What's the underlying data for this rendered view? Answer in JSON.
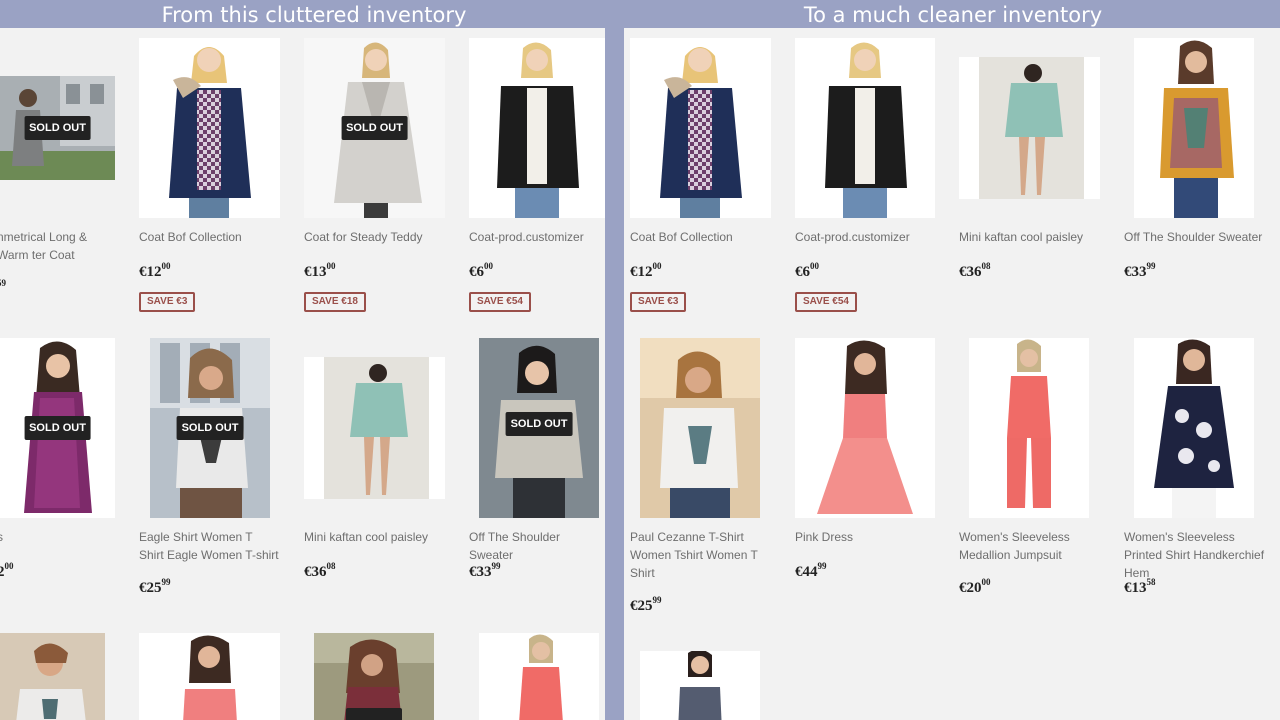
{
  "headings": {
    "left": "From this cluttered inventory",
    "right": "To a much cleaner inventory"
  },
  "colors": {
    "bar": "#9aa2c4",
    "panel": "#f2f2f2",
    "save_border": "#9a4f4a",
    "sold_badge": "#222222"
  },
  "left": {
    "products": [
      {
        "name": "nmetrical Long & Warm ter Coat",
        "price_main": "",
        "price_cents": "59",
        "save": "",
        "sold_out": "SOLD OUT",
        "icon": "grey-coat-photo"
      },
      {
        "name": "Coat Bof Collection",
        "price_main": "€12",
        "price_cents": "00",
        "save": "SAVE €3",
        "sold_out": "",
        "icon": "navy-parka-photo"
      },
      {
        "name": "Coat for Steady Teddy",
        "price_main": "€13",
        "price_cents": "00",
        "save": "SAVE €18",
        "sold_out": "SOLD OUT",
        "icon": "beige-coat-photo"
      },
      {
        "name": "Coat-prod.customizer",
        "price_main": "€6",
        "price_cents": "00",
        "save": "SAVE €54",
        "sold_out": "",
        "icon": "leather-jacket-photo"
      },
      {
        "name": "s",
        "price_main": "",
        "price_cents": "00",
        "price_prefix": "2",
        "save": "",
        "sold_out": "SOLD OUT",
        "icon": "purple-dress-photo"
      },
      {
        "name": "Eagle Shirt Women T Shirt Eagle Women T-shirt",
        "price_main": "€25",
        "price_cents": "99",
        "save": "",
        "sold_out": "SOLD OUT",
        "icon": "eagle-tshirt-photo"
      },
      {
        "name": "Mini kaftan cool paisley",
        "price_main": "€36",
        "price_cents": "08",
        "save": "",
        "sold_out": "",
        "icon": "kaftan-photo"
      },
      {
        "name": "Off The Shoulder Sweater",
        "price_main": "€33",
        "price_cents": "99",
        "save": "",
        "sold_out": "SOLD OUT",
        "icon": "sweater-photo"
      },
      {
        "name": "",
        "icon": "tshirt-photo"
      },
      {
        "name": "",
        "icon": "pink-dress-photo"
      },
      {
        "name": "",
        "icon": "floral-dress-photo"
      },
      {
        "name": "",
        "icon": "jumpsuit-photo"
      }
    ]
  },
  "right": {
    "products": [
      {
        "name": "Coat Bof Collection",
        "price_main": "€12",
        "price_cents": "00",
        "save": "SAVE €3",
        "icon": "navy-parka-photo"
      },
      {
        "name": "Coat-prod.customizer",
        "price_main": "€6",
        "price_cents": "00",
        "save": "SAVE €54",
        "icon": "leather-jacket-photo"
      },
      {
        "name": "Mini kaftan cool paisley",
        "price_main": "€36",
        "price_cents": "08",
        "save": "",
        "icon": "kaftan-photo"
      },
      {
        "name": "Off The Shoulder Sweater",
        "price_main": "€33",
        "price_cents": "99",
        "save": "",
        "icon": "paisley-top-photo"
      },
      {
        "name": "Paul Cezanne T-Shirt Women Tshirt Women T Shirt",
        "price_main": "€25",
        "price_cents": "99",
        "save": "",
        "icon": "tshirt-photo"
      },
      {
        "name": "Pink Dress",
        "price_main": "€44",
        "price_cents": "99",
        "save": "",
        "icon": "pink-dress-photo"
      },
      {
        "name": "Women's Sleeveless Medallion Jumpsuit",
        "price_main": "€20",
        "price_cents": "00",
        "save": "",
        "icon": "jumpsuit-photo"
      },
      {
        "name": "Women's Sleeveless Printed Shirt Handkerchief Hem",
        "price_main": "€13",
        "price_cents": "58",
        "save": "",
        "icon": "printed-top-photo"
      },
      {
        "name": "",
        "icon": "strapless-top-photo"
      }
    ]
  }
}
